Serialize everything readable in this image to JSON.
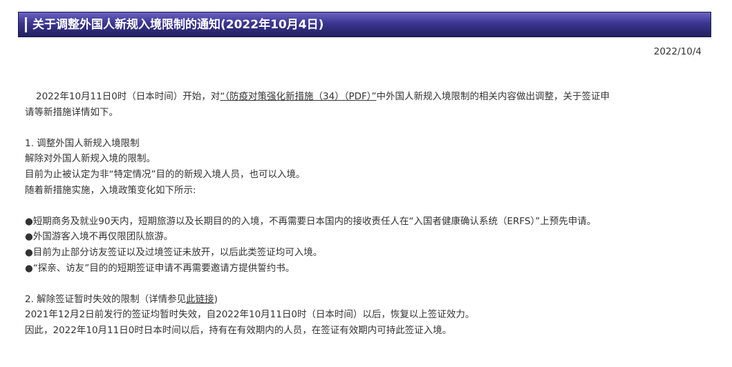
{
  "title": "关于调整外国人新规入境限制的通知(2022年10月4日)",
  "date": "2022/10/4",
  "intro": {
    "prefix": "2022年10月11日0时（日本时间）开始，对",
    "link_text": "“（防疫对策强化新措施（34）（PDF）”",
    "middle": "中外国人新规入境限制的相关内容做出调整，关于签证申",
    "line2": "请等新措施详情如下。"
  },
  "section1": {
    "heading": "1. 调整外国人新规入境限制",
    "lines": [
      "解除对外国人新规入境的限制。",
      "目前为止被认定为非“特定情况”目的的新规入境人员，也可以入境。",
      "随着新措施实施，入境政策变化如下所示:"
    ],
    "bullets": [
      "●短期商务及就业90天内，短期旅游以及长期目的的入境，不再需要日本国内的接收责任人在“入国者健康确认系统（ERFS）”上预先申请。",
      "●外国游客入境不再仅限团队旅游。",
      "●目前为止部分访友签证以及过境签证未放开，以后此类签证均可入境。",
      "●“探亲、访友”目的的短期签证申请不再需要邀请方提供誓约书。"
    ]
  },
  "section2": {
    "heading_prefix": "2. 解除签证暂时失效的限制（详情参见",
    "heading_link": "此链接",
    "heading_suffix": ")",
    "lines": [
      "2021年12月2日前发行的签证均暂时失效，自2022年10月11日0时（日本时间）以后，恢复以上签证效力。",
      "因此，2022年10月11日0时日本时间以后，持有在有效期内的人员，在签证有效期内可持此签证入境。"
    ]
  }
}
